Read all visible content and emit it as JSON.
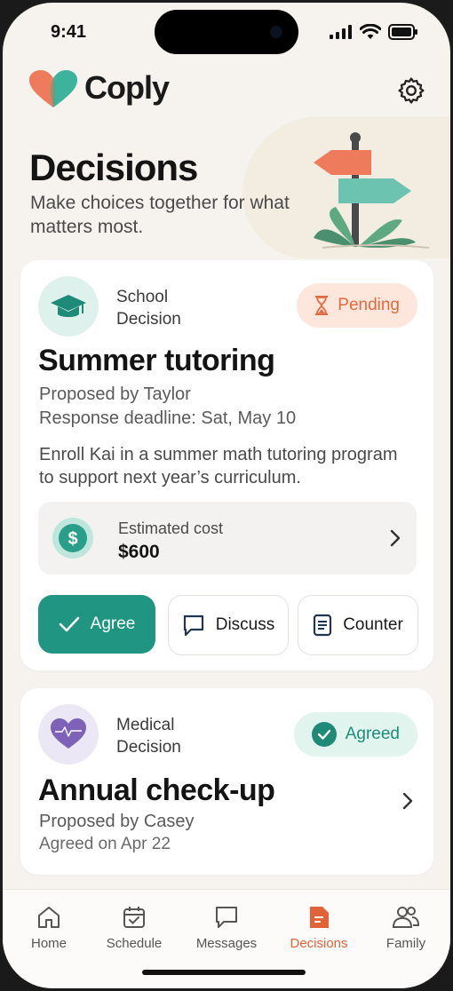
{
  "status": {
    "time": "9:41"
  },
  "app": {
    "name": "Coply"
  },
  "page": {
    "title": "Decisions",
    "subtitle": "Make choices together for what matters most."
  },
  "decisions": [
    {
      "category": "School Decision",
      "status": "Pending",
      "title": "Summer tutoring",
      "proposed_by": "Proposed by Taylor",
      "deadline": "Response deadline: Sat, May 10",
      "description": "Enroll Kai in a summer math tutoring program to support next year’s curriculum.",
      "cost_label": "Estimated cost",
      "cost_value": "$600",
      "actions": {
        "agree": "Agree",
        "discuss": "Discuss",
        "counter": "Counter"
      }
    },
    {
      "category": "Medical Decision",
      "status": "Agreed",
      "title": "Annual check-up",
      "proposed_by": "Proposed by Casey",
      "agreed_on": "Agreed on Apr 22"
    }
  ],
  "tabs": [
    {
      "label": "Home",
      "icon": "home-icon"
    },
    {
      "label": "Schedule",
      "icon": "calendar-icon"
    },
    {
      "label": "Messages",
      "icon": "message-icon"
    },
    {
      "label": "Decisions",
      "icon": "decision-doc-icon",
      "active": true
    },
    {
      "label": "Family",
      "icon": "family-icon"
    }
  ],
  "colors": {
    "accent": "#1f9582",
    "pending": "#e56a3f",
    "active_tab": "#e2623a",
    "background": "#f6f3ee"
  }
}
